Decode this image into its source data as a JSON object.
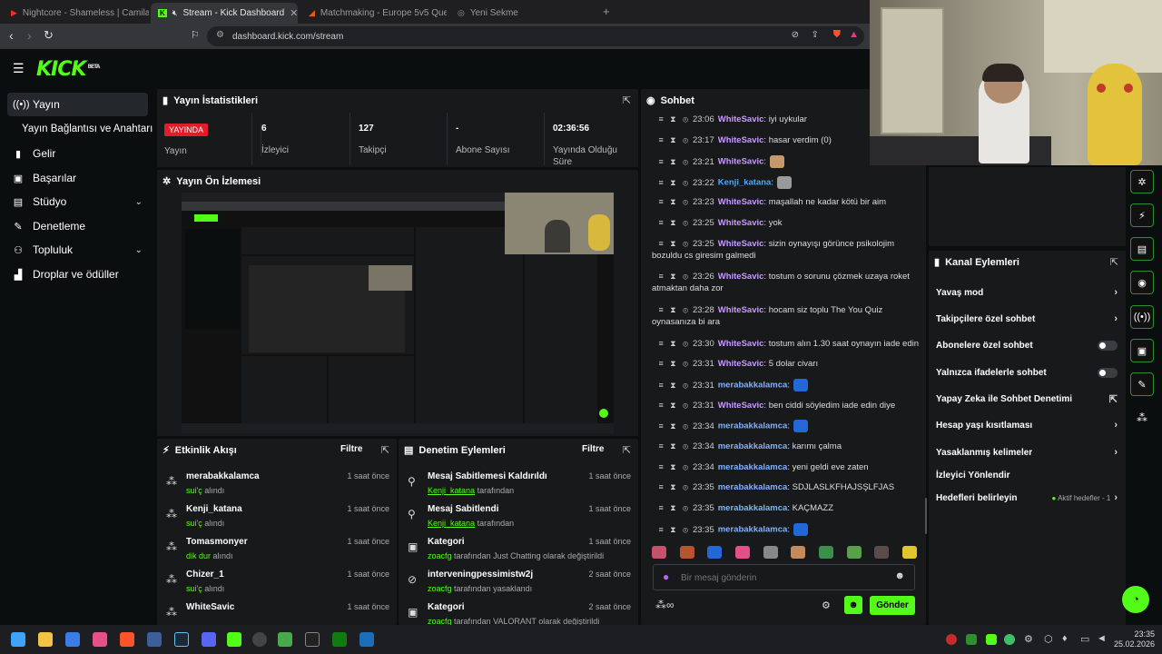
{
  "browser": {
    "tabs": [
      {
        "title": "Nightcore - Shameless | Camila C",
        "icon": "youtube-icon",
        "active": false
      },
      {
        "title": "Stream - Kick Dashboard",
        "icon": "kick-icon",
        "active": true
      },
      {
        "title": "Matchmaking - Europe 5v5 Queue -",
        "icon": "faceit-icon",
        "active": false
      },
      {
        "title": "Yeni Sekme",
        "icon": "new-tab-icon",
        "active": false
      }
    ],
    "url": "dashboard.kick.com/stream"
  },
  "kick": {
    "logo": "KICK",
    "beta": "BETA"
  },
  "sidebar": {
    "items": [
      {
        "label": "Yayın",
        "icon": "broadcast-icon",
        "active": true
      },
      {
        "label": "Yayın Bağlantısı ve Anahtarı",
        "icon": "",
        "active": false
      },
      {
        "label": "Gelir",
        "icon": "chart-icon",
        "active": false
      },
      {
        "label": "Başarılar",
        "icon": "trophy-icon",
        "active": false
      },
      {
        "label": "Stüdyo",
        "icon": "grid-icon",
        "active": false
      },
      {
        "label": "Denetleme",
        "icon": "wrench-icon",
        "active": false
      },
      {
        "label": "Topluluk",
        "icon": "people-icon",
        "active": false
      },
      {
        "label": "Droplar ve ödüller",
        "icon": "gift-icon",
        "active": false
      }
    ]
  },
  "stats": {
    "title": "Yayın İstatistikleri",
    "live_badge": "YAYINDA",
    "live_label": "Yayın",
    "viewers_value": "6",
    "viewers_label": "İzleyici",
    "followers_value": "127",
    "followers_label": "Takipçi",
    "subs_value": "-",
    "subs_label": "Abone Sayısı",
    "uptime_value": "02:36:56",
    "uptime_label": "Yayında Olduğu Süre"
  },
  "preview": {
    "title": "Yayın Ön İzlemesi"
  },
  "feed": {
    "title": "Etkinlik Akışı",
    "filter": "Filtre",
    "items": [
      {
        "name": "merabakkalamca",
        "action": "sui'ç",
        "suffix": "alındı",
        "time": "1 saat önce"
      },
      {
        "name": "Kenji_katana",
        "action": "sui'ç",
        "suffix": "alındı",
        "time": "1 saat önce"
      },
      {
        "name": "Tomasmonyer",
        "action": "dik dur",
        "suffix": "alındı",
        "time": "1 saat önce"
      },
      {
        "name": "Chizer_1",
        "action": "sui'ç",
        "suffix": "alındı",
        "time": "1 saat önce"
      },
      {
        "name": "WhiteSavic",
        "action": "",
        "suffix": "",
        "time": "1 saat önce"
      }
    ]
  },
  "modlog": {
    "title": "Denetim Eylemleri",
    "filter": "Filtre",
    "items": [
      {
        "title": "Mesaj Sabitlemesi Kaldırıldı",
        "by": "Kenji_katana",
        "rest": "tarafından",
        "time": "1 saat önce",
        "icon": "unpin-icon"
      },
      {
        "title": "Mesaj Sabitlendi",
        "by": "Kenji_katana",
        "rest": "tarafından",
        "time": "1 saat önce",
        "icon": "pin-icon"
      },
      {
        "title": "Kategori",
        "by": "zoacfg",
        "rest": "tarafından Just Chatting olarak değiştirildi",
        "time": "1 saat önce",
        "icon": "category-icon"
      },
      {
        "title": "interveningpessimistw2j",
        "by": "zoacfg",
        "rest": "tarafından yasaklandı",
        "time": "2 saat önce",
        "icon": "ban-icon"
      },
      {
        "title": "Kategori",
        "by": "zoacfg",
        "rest": "tarafından VALORANT olarak değiştirildi",
        "time": "2 saat önce",
        "icon": "category-icon"
      }
    ]
  },
  "chat": {
    "title": "Sohbet",
    "placeholder": "Bir mesaj gönderin",
    "send": "Gönder",
    "messages": [
      {
        "time": "23:06",
        "user": "WhiteSavic",
        "color": "#c79bff",
        "text": ": iyi uykular"
      },
      {
        "time": "23:17",
        "user": "WhiteSavic",
        "color": "#c79bff",
        "text": ": hasar verdim (0)"
      },
      {
        "time": "23:21",
        "user": "WhiteSavic",
        "color": "#c79bff",
        "text": ":"
      },
      {
        "time": "23:22",
        "user": "Kenji_katana",
        "color": "#4aa8ff",
        "text": ":"
      },
      {
        "time": "23:23",
        "user": "WhiteSavic",
        "color": "#c79bff",
        "text": ": maşallah ne kadar kötü bir aim"
      },
      {
        "time": "23:25",
        "user": "WhiteSavic",
        "color": "#c79bff",
        "text": ": yok"
      },
      {
        "time": "23:25",
        "user": "WhiteSavic",
        "color": "#c79bff",
        "text": ": sizin oynayışı görünce psikolojim bozuldu cs giresim galmedi"
      },
      {
        "time": "23:26",
        "user": "WhiteSavic",
        "color": "#c79bff",
        "text": ": tostum o sorunu çözmek uzaya roket atmaktan daha zor"
      },
      {
        "time": "23:28",
        "user": "WhiteSavic",
        "color": "#c79bff",
        "text": ": hocam siz toplu The You Quiz oynasanıza bi ara"
      },
      {
        "time": "23:30",
        "user": "WhiteSavic",
        "color": "#c79bff",
        "text": ": tostum alın 1.30 saat oynayın iade edin"
      },
      {
        "time": "23:31",
        "user": "WhiteSavic",
        "color": "#c79bff",
        "text": ": 5 dolar civarı"
      },
      {
        "time": "23:31",
        "user": "merabakkalamca",
        "color": "#7fb2ff",
        "text": ":"
      },
      {
        "time": "23:31",
        "user": "WhiteSavic",
        "color": "#c79bff",
        "text": ": ben ciddi söyledim iade edin diye"
      },
      {
        "time": "23:34",
        "user": "merabakkalamca",
        "color": "#7fb2ff",
        "text": ":"
      },
      {
        "time": "23:34",
        "user": "merabakkalamca",
        "color": "#7fb2ff",
        "text": ": karımı çalma"
      },
      {
        "time": "23:34",
        "user": "merabakkalamca",
        "color": "#7fb2ff",
        "text": ": yeni geldi eve zaten"
      },
      {
        "time": "23:35",
        "user": "merabakkalamca",
        "color": "#7fb2ff",
        "text": ": SDJLASLKFHAJSŞLFJAS"
      },
      {
        "time": "23:35",
        "user": "merabakkalamca",
        "color": "#7fb2ff",
        "text": ": KAÇMAZZ"
      },
      {
        "time": "23:35",
        "user": "merabakkalamca",
        "color": "#7fb2ff",
        "text": ":"
      }
    ]
  },
  "channel_actions": {
    "title": "Kanal Eylemleri",
    "items": [
      {
        "label": "Yavaş mod",
        "kind": "chevron"
      },
      {
        "label": "Takipçilere özel sohbet",
        "kind": "chevron"
      },
      {
        "label": "Abonelere özel sohbet",
        "kind": "toggle"
      },
      {
        "label": "Yalnızca ifadelerle sohbet",
        "kind": "toggle"
      },
      {
        "label": "Yapay Zeka ile Sohbet Denetimi",
        "kind": "external"
      },
      {
        "label": "Hesap yaşı kısıtlaması",
        "kind": "chevron"
      },
      {
        "label": "Yasaklanmış kelimeler",
        "kind": "chevron"
      },
      {
        "label": "İzleyici Yönlendir",
        "kind": "none"
      },
      {
        "label": "Hedefleri belirleyin",
        "kind": "chevron"
      }
    ],
    "goals_status": "Aktif hedefler - 1"
  },
  "taskbar": {
    "time": "23:35",
    "date": "25.02.2026"
  },
  "colors": {
    "accent": "#53fc18",
    "panel": "#18191b",
    "background": "#0b0e0f",
    "live": "#e01e2b"
  }
}
